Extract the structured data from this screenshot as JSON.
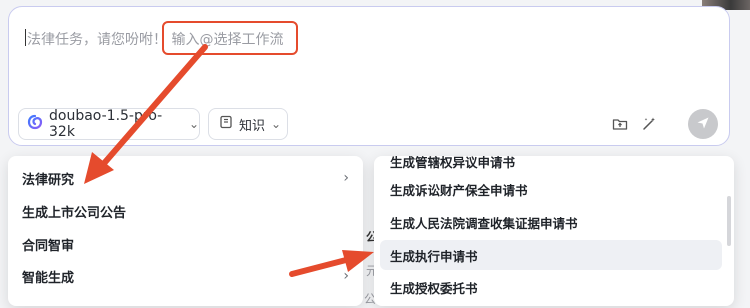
{
  "chat_input": {
    "placeholder": "法律任务，请您吩咐！ 输入@选择工作流"
  },
  "toolbar": {
    "model_label": "doubao-1.5-pro-32k",
    "knowledge_label": "知识"
  },
  "menu": {
    "items": [
      {
        "label": "法律研究",
        "has_submenu": true
      },
      {
        "label": "生成上市公司公告",
        "has_submenu": false
      },
      {
        "label": "合同智审",
        "has_submenu": false
      },
      {
        "label": "智能生成",
        "has_submenu": true
      }
    ]
  },
  "submenu": {
    "items": [
      {
        "label": "生成管辖权异议申请书"
      },
      {
        "label": "生成诉讼财产保全申请书"
      },
      {
        "label": "生成人民法院调查收集证据申请书"
      },
      {
        "label": "生成执行申请书",
        "selected": true
      },
      {
        "label": "生成授权委托书"
      }
    ]
  },
  "background": {
    "fragment_1": "公",
    "fragment_2": "元",
    "fragment_3": "公告"
  },
  "colors": {
    "annotation_red": "#e54b2d",
    "accent": "#4e6ef2"
  }
}
